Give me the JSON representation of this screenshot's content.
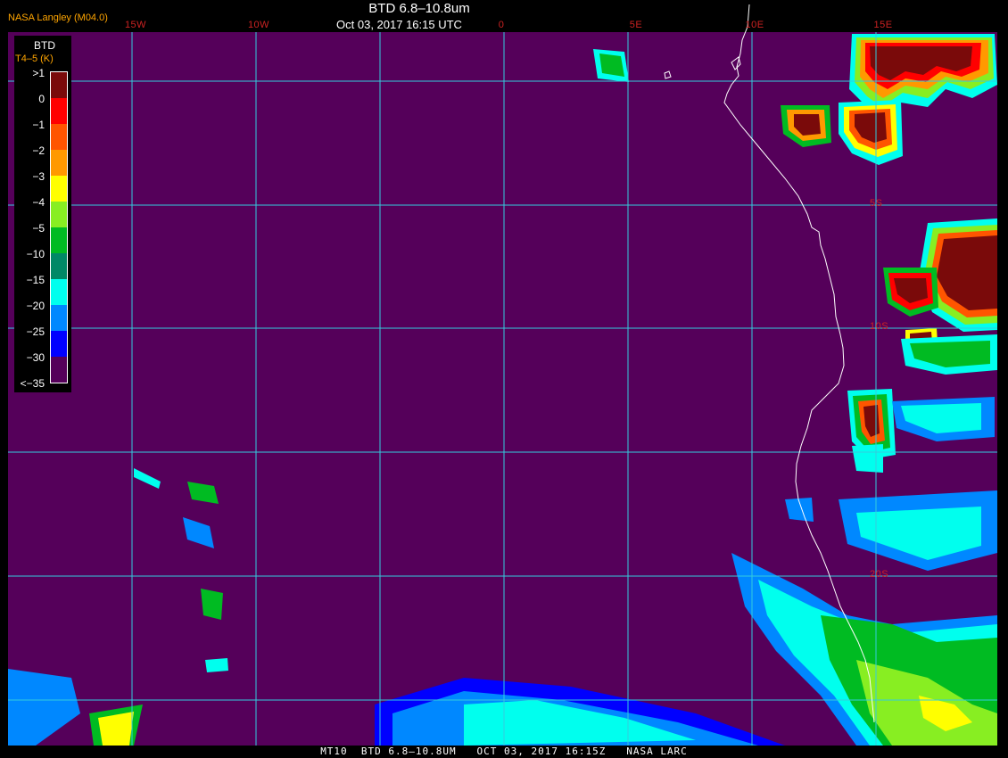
{
  "header": {
    "credit": "NASA Langley (M04.0)",
    "title": "BTD 6.8–10.8um",
    "datetime": "Oct 03, 2017 16:15 UTC"
  },
  "grid": {
    "longitude_labels": [
      "15W",
      "10W",
      "0",
      "5E",
      "10E",
      "15E"
    ],
    "latitude_labels": [
      "5S",
      "10S",
      "20S"
    ]
  },
  "legend": {
    "title": "BTD",
    "subtitle": "T4–5 (K)",
    "items": [
      {
        "label": ">1",
        "color": "#7a0a0a"
      },
      {
        "label": "0",
        "color": "#ff0000"
      },
      {
        "label": "−1",
        "color": "#ff5500"
      },
      {
        "label": "−2",
        "color": "#ff9900"
      },
      {
        "label": "−3",
        "color": "#ffff00"
      },
      {
        "label": "−4",
        "color": "#88ee22"
      },
      {
        "label": "−5",
        "color": "#00bb22"
      },
      {
        "label": "−10",
        "color": "#008866"
      },
      {
        "label": "−15",
        "color": "#00ffee"
      },
      {
        "label": "−20",
        "color": "#0088ff"
      },
      {
        "label": "−25",
        "color": "#0000ff"
      },
      {
        "label": "−30",
        "color": "#55005a"
      },
      {
        "label": "<−35",
        "color": null
      }
    ]
  },
  "footer": {
    "text": "MT10  BTD 6.8–10.8UM   OCT 03, 2017 16:15Z   NASA LARC"
  },
  "colors": {
    "background": "#55005a",
    "grid": "#33ccdd",
    "coast": "#ffffff",
    "label_red": "#cc2222",
    "label_orange": "#ffa500"
  }
}
